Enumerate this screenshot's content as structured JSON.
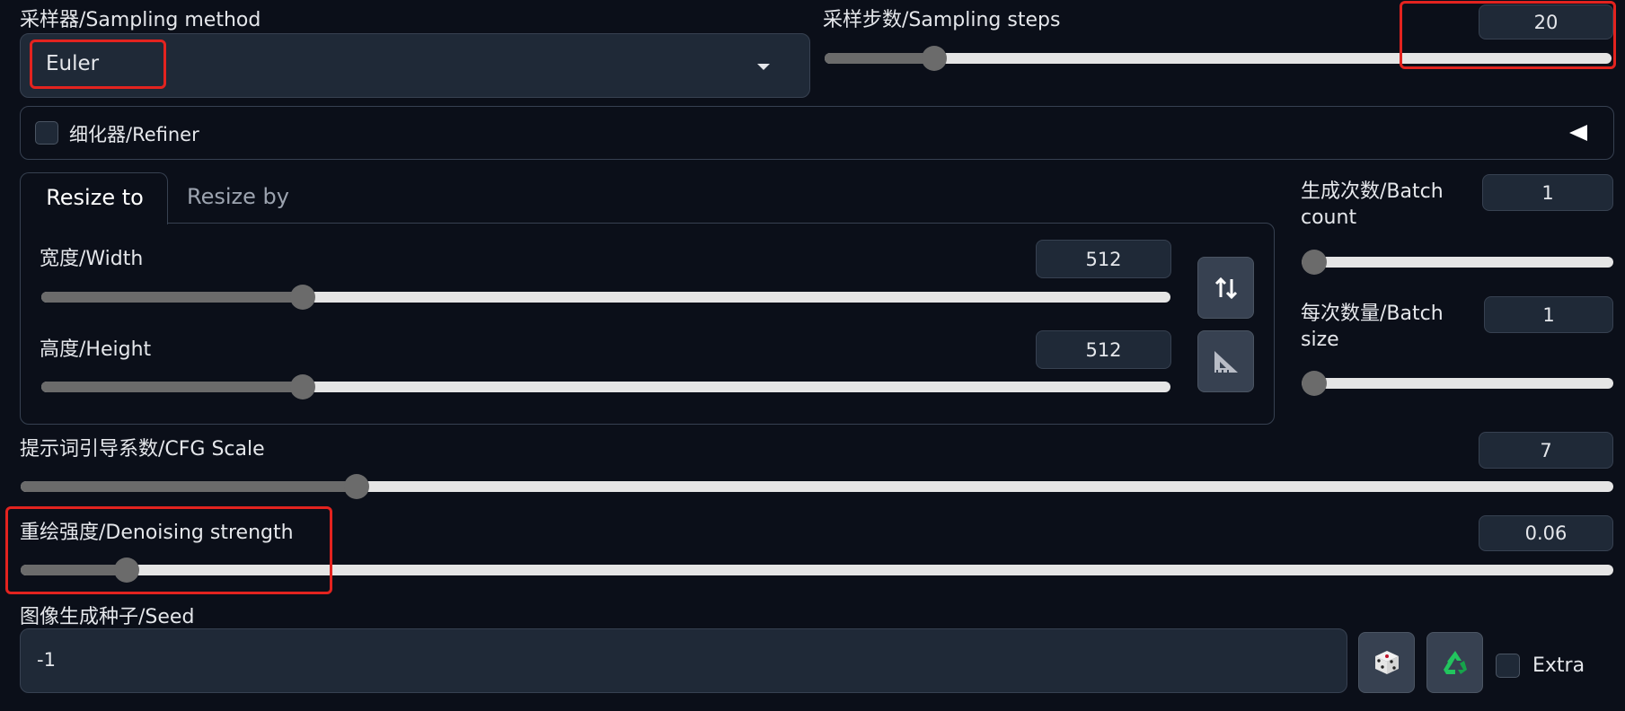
{
  "sampling_method": {
    "label": "采样器/Sampling method",
    "value": "Euler",
    "dropdown_icon": "caret-down-icon"
  },
  "sampling_steps": {
    "label": "采样步数/Sampling steps",
    "value": "20",
    "slider_fraction": 0.14
  },
  "refiner": {
    "label": "细化器/Refiner",
    "checked": false,
    "toggle_icon": "triangle-left-icon"
  },
  "resize_tabs": {
    "active": "Resize to",
    "inactive": "Resize by"
  },
  "width": {
    "label": "宽度/Width",
    "value": "512",
    "slider_fraction": 0.23
  },
  "height": {
    "label": "高度/Height",
    "value": "512",
    "slider_fraction": 0.23
  },
  "swap_dimensions_icon": "swap-vertical-icon",
  "aspect_ratio_icon": "set-square-icon",
  "batch_count": {
    "label_line1": "生成次数/Batch",
    "label_line2": "count",
    "value": "1",
    "slider_fraction": 0.0
  },
  "batch_size": {
    "label_line1": "每次数量/Batch",
    "label_line2": "size",
    "value": "1",
    "slider_fraction": 0.0
  },
  "cfg_scale": {
    "label": "提示词引导系数/CFG Scale",
    "value": "7",
    "slider_fraction": 0.21
  },
  "denoising_strength": {
    "label": "重绘强度/Denoising strength",
    "value": "0.06",
    "slider_fraction": 0.066
  },
  "seed": {
    "label": "图像生成种子/Seed",
    "value": "-1",
    "random_icon": "dice-icon",
    "reuse_icon": "recycle-icon",
    "extra_label": "Extra",
    "extra_checked": false
  },
  "colors": {
    "background": "#0b0f19",
    "panel": "#1f2937",
    "highlight": "#e3231f"
  }
}
